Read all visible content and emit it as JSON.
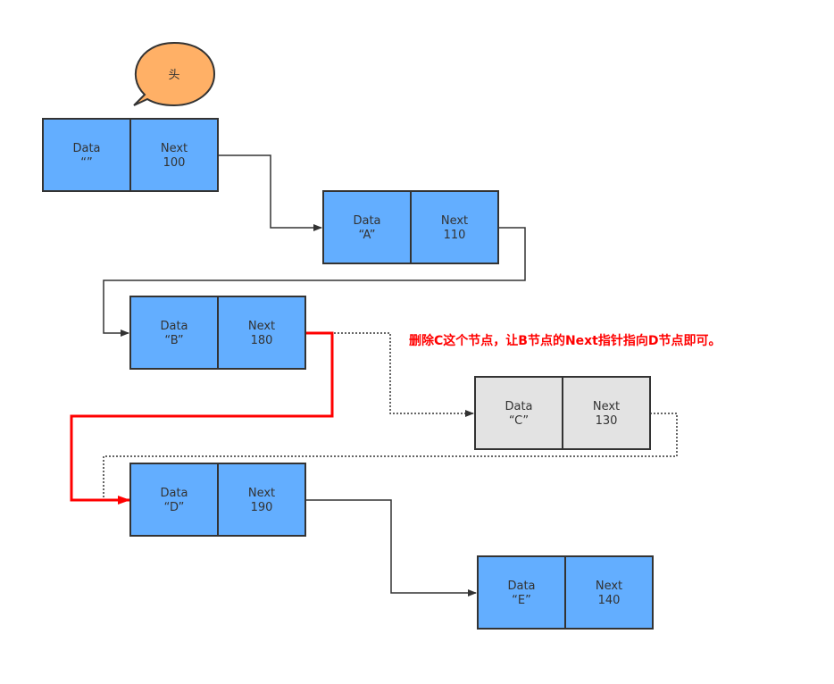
{
  "head_label": "头",
  "note": "删除C这个节点，让B节点的Next指针指向D节点即可。",
  "nodes": {
    "head": {
      "data_label": "Data",
      "data_value": "“”",
      "next_label": "Next",
      "next_value": "100"
    },
    "a": {
      "data_label": "Data",
      "data_value": "“A”",
      "next_label": "Next",
      "next_value": "110"
    },
    "b": {
      "data_label": "Data",
      "data_value": "“B”",
      "next_label": "Next",
      "next_value": "180"
    },
    "c": {
      "data_label": "Data",
      "data_value": "“C”",
      "next_label": "Next",
      "next_value": "130"
    },
    "d": {
      "data_label": "Data",
      "data_value": "“D”",
      "next_label": "Next",
      "next_value": "190"
    },
    "e": {
      "data_label": "Data",
      "data_value": "“E”",
      "next_label": "Next",
      "next_value": "140"
    }
  },
  "colors": {
    "node": "#63aeff",
    "deleted_node": "#e3e3e3",
    "bubble": "#ffb066",
    "highlight": "#ff0000"
  }
}
